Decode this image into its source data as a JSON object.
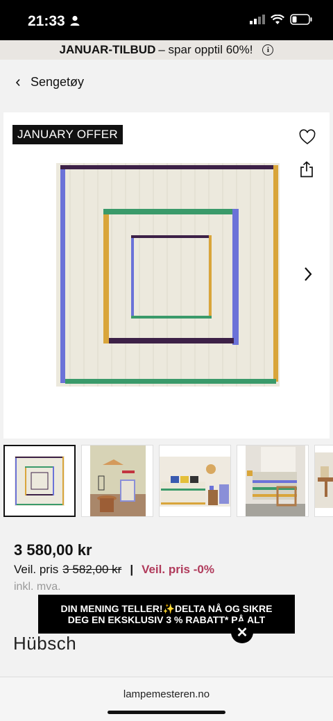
{
  "status_bar": {
    "time": "21:33"
  },
  "promo": {
    "bold": "JANUAR-TILBUD",
    "rest": "– spar opptil 60%!"
  },
  "breadcrumb": {
    "label": "Sengetøy"
  },
  "product": {
    "badge": "JANUARY OFFER",
    "price": "3 580,00 kr",
    "ref_label": "Veil. pris",
    "ref_price": "3 582,00 kr",
    "discount": "Veil. pris -0%",
    "vat": "inkl. mva."
  },
  "popup": {
    "line1": "DIN MENING TELLER!✨DELTA NÅ OG SIKRE",
    "line2": "DEG EN EKSKLUSIV 3 % RABATT* PÅ ALT"
  },
  "brand": {
    "logo_text": "Hübsch"
  },
  "browser": {
    "url": "lampemesteren.no"
  },
  "colors": {
    "discount": "#b03a5b",
    "badge_bg": "#111111"
  }
}
